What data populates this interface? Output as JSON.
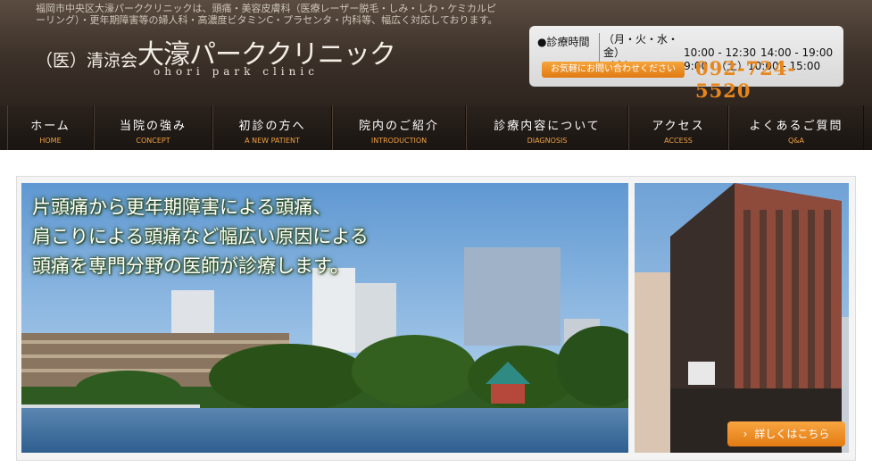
{
  "header": {
    "tagline": "福岡市中央区大濠パーククリニックは、頭痛・美容皮膚科（医療レーザー脱毛・しみ・しわ・ケミカルピーリング）・更年期障害等の婦人科・高濃度ビタミンC・プラセンタ・内科等、幅広く対応しております。",
    "logo_prefix": "（医）清涼会",
    "logo_name": "大濠パーククリニック",
    "logo_sub": "ohori park clinic"
  },
  "hours": {
    "title": "●診療時間",
    "rows": [
      {
        "days": "（月・火・水・金）",
        "time1": "10:00 - 12:30",
        "time2": "14:00 - 19:00"
      },
      {
        "days": "（木）14:00 - 19:00",
        "time1": "（土）10:00 - 15:00",
        "time2": ""
      }
    ],
    "contact_label": "お気軽にお問い合わせください",
    "phone": "092-724-5520"
  },
  "nav": [
    {
      "jp": "ホーム",
      "en": "HOME"
    },
    {
      "jp": "当院の強み",
      "en": "CONCEPT"
    },
    {
      "jp": "初診の方へ",
      "en": "A NEW PATIENT"
    },
    {
      "jp": "院内のご紹介",
      "en": "INTRODUCTION"
    },
    {
      "jp": "診療内容について",
      "en": "DIAGNOSIS"
    },
    {
      "jp": "アクセス",
      "en": "ACCESS"
    },
    {
      "jp": "よくあるご質問",
      "en": "Q&A"
    }
  ],
  "banner": {
    "headline_lines": [
      "片頭痛から更年期障害による頭痛、",
      "肩こりによる頭痛など幅広い原因による",
      "頭痛を専門分野の医師が診療します。"
    ],
    "more_label": "詳しくはこちら"
  },
  "colors": {
    "accent": "#e8861b",
    "nav_bg": "#1a1512",
    "header_bg": "#3c3129"
  }
}
